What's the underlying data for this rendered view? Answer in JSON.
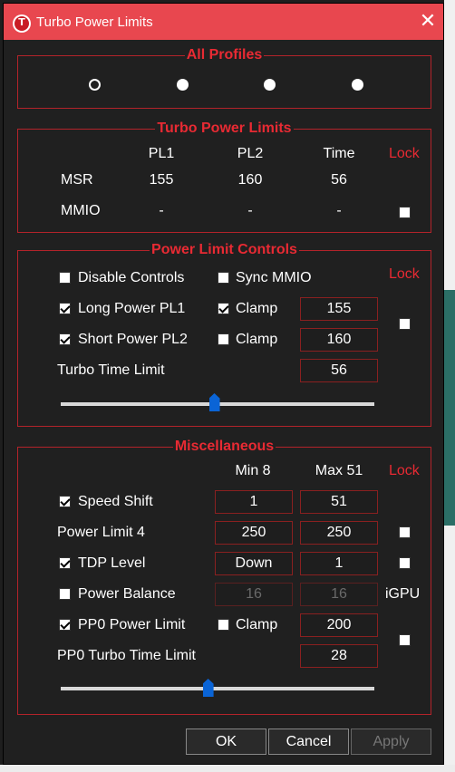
{
  "window": {
    "title": "Turbo Power Limits",
    "icon_letter": "T",
    "close_glyph": "✕"
  },
  "all_profiles": {
    "title": "All Profiles",
    "selected_index": 0,
    "count": 4
  },
  "turbo_power_limits": {
    "title": "Turbo Power Limits",
    "headers": {
      "pl1": "PL1",
      "pl2": "PL2",
      "time": "Time",
      "lock": "Lock"
    },
    "msr": {
      "label": "MSR",
      "pl1": "155",
      "pl2": "160",
      "time": "56"
    },
    "mmio": {
      "label": "MMIO",
      "pl1": "-",
      "pl2": "-",
      "time": "-",
      "lock_checked": false
    }
  },
  "power_limit_controls": {
    "title": "Power Limit Controls",
    "lock": "Lock",
    "disable_controls": {
      "label": "Disable Controls",
      "checked": false
    },
    "sync_mmio": {
      "label": "Sync MMIO",
      "checked": false
    },
    "long_power": {
      "label": "Long Power PL1",
      "checked": true,
      "clamp_label": "Clamp",
      "clamp_checked": true,
      "value": "155"
    },
    "short_power": {
      "label": "Short Power PL2",
      "checked": true,
      "clamp_label": "Clamp",
      "clamp_checked": false,
      "value": "160"
    },
    "turbo_time": {
      "label": "Turbo Time Limit",
      "value": "56"
    },
    "lock_checked": false,
    "slider_fraction": 0.49
  },
  "miscellaneous": {
    "title": "Miscellaneous",
    "min_label": "Min  8",
    "max_label": "Max  51",
    "lock": "Lock",
    "speed_shift": {
      "label": "Speed Shift",
      "checked": true,
      "min": "1",
      "max": "51"
    },
    "power_limit_4": {
      "label": "Power Limit 4",
      "min": "250",
      "max": "250",
      "lock_checked": false
    },
    "tdp_level": {
      "label": "TDP Level",
      "checked": true,
      "min": "Down",
      "max": "1",
      "lock_checked": false
    },
    "power_balance": {
      "label": "Power Balance",
      "checked": false,
      "min": "16",
      "max": "16",
      "igpu": "iGPU"
    },
    "pp0_power": {
      "label": "PP0 Power Limit",
      "checked": true,
      "clamp_label": "Clamp",
      "clamp_checked": false,
      "value": "200"
    },
    "pp0_turbo_time": {
      "label": "PP0 Turbo Time Limit",
      "value": "28"
    },
    "pp0_lock_checked": false,
    "slider_fraction": 0.47
  },
  "buttons": {
    "ok": "OK",
    "cancel": "Cancel",
    "apply": "Apply"
  }
}
